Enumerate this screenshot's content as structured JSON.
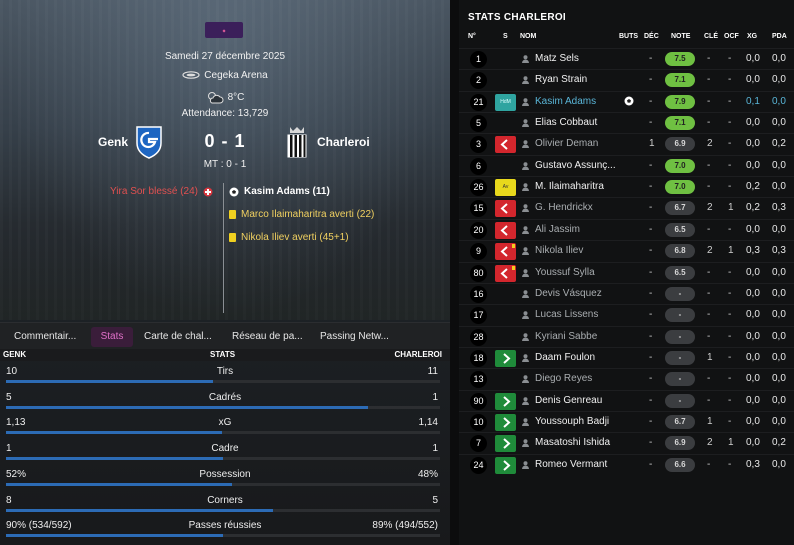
{
  "match": {
    "league_logo": "league-logo",
    "date": "Samedi 27 décembre 2025",
    "venue": "Cegeka Arena",
    "weather": "8°C",
    "attendance": "Attendance: 13,729",
    "home_team": "Genk",
    "away_team": "Charleroi",
    "score": "0 - 1",
    "half_time": "MT : 0 - 1",
    "home_events": [
      {
        "text": "Yira Sor blessé (24)",
        "icon": "injury-icon"
      }
    ],
    "away_events": [
      {
        "text": "Kasim Adams (11)",
        "icon": "goal-ball-icon"
      },
      {
        "text": "Marco Ilaimaharitra averti (22)",
        "icon": "yellow-card-icon"
      },
      {
        "text": "Nikola Iliev averti (45+1)",
        "icon": "yellow-card-icon"
      }
    ]
  },
  "tabs": [
    "Commentair...",
    "Stats",
    "Carte de chal...",
    "Réseau de pa...",
    "Passing Netw..."
  ],
  "active_tab": "Stats",
  "stats": {
    "home_header": "GENK",
    "center_header": "STATS",
    "away_header": "CHARLEROI",
    "rows": [
      {
        "label": "Tirs",
        "home": "10",
        "away": "11",
        "home_share": 0.476
      },
      {
        "label": "Cadrés",
        "home": "5",
        "away": "1",
        "home_share": 0.833
      },
      {
        "label": "xG",
        "home": "1,13",
        "away": "1,14",
        "home_share": 0.498
      },
      {
        "label": "Cadre",
        "home": "1",
        "away": "1",
        "home_share": 0.5
      },
      {
        "label": "Possession",
        "home": "52%",
        "away": "48%",
        "home_share": 0.52
      },
      {
        "label": "Corners",
        "home": "8",
        "away": "5",
        "home_share": 0.615
      },
      {
        "label": "Passes réussies",
        "home": "90% (534/592)",
        "away": "89% (494/552)",
        "home_share": 0.5
      }
    ]
  },
  "team_stats": {
    "title": "STATS CHARLEROI",
    "columns": {
      "num": "N°",
      "s": "S",
      "nom": "NOM",
      "buts": "BUTS",
      "dec": "DÉC",
      "note": "NOTE",
      "cle": "CLÉ",
      "ocf": "OCF",
      "xg": "XG",
      "pda": "PDA"
    },
    "colors": {
      "good_rating": "#6fc042",
      "sub_in": "#1f8b3a",
      "sub_out": "#d3262d",
      "highlight": "#5ab6d8"
    },
    "players": [
      {
        "num": "1",
        "badge": "",
        "name": "Matz Sels",
        "dim": false,
        "hl": false,
        "goal": false,
        "dec": "-",
        "note": "7.5",
        "good": true,
        "cle": "-",
        "ocf": "-",
        "xg": "0,0",
        "pda": "0,0"
      },
      {
        "num": "2",
        "badge": "",
        "name": "Ryan Strain",
        "dim": false,
        "hl": false,
        "goal": false,
        "dec": "-",
        "note": "7.1",
        "good": true,
        "cle": "-",
        "ocf": "-",
        "xg": "0,0",
        "pda": "0,0"
      },
      {
        "num": "21",
        "badge": "teal",
        "badge_text": "HdM",
        "name": "Kasim Adams",
        "dim": false,
        "hl": true,
        "goal": true,
        "dec": "-",
        "note": "7.9",
        "good": true,
        "cle": "-",
        "ocf": "-",
        "xg": "0,1",
        "pda": "0,0"
      },
      {
        "num": "5",
        "badge": "",
        "name": "Elias Cobbaut",
        "dim": false,
        "hl": false,
        "goal": false,
        "dec": "-",
        "note": "7.1",
        "good": true,
        "cle": "-",
        "ocf": "-",
        "xg": "0,0",
        "pda": "0,0"
      },
      {
        "num": "3",
        "badge": "out",
        "name": "Olivier Deman",
        "dim": true,
        "hl": false,
        "goal": false,
        "dec": "1",
        "note": "6.9",
        "good": false,
        "cle": "2",
        "ocf": "-",
        "xg": "0,0",
        "pda": "0,2"
      },
      {
        "num": "6",
        "badge": "",
        "name": "Gustavo Assunç...",
        "dim": false,
        "hl": false,
        "goal": false,
        "dec": "-",
        "note": "7.0",
        "good": true,
        "cle": "-",
        "ocf": "-",
        "xg": "0,0",
        "pda": "0,0"
      },
      {
        "num": "26",
        "badge": "yellow",
        "badge_text": "Av",
        "name": "M. Ilaimaharitra",
        "dim": false,
        "hl": false,
        "goal": false,
        "dec": "-",
        "note": "7.0",
        "good": true,
        "cle": "-",
        "ocf": "-",
        "xg": "0,2",
        "pda": "0,0"
      },
      {
        "num": "15",
        "badge": "out",
        "name": "G. Hendrickx",
        "dim": true,
        "hl": false,
        "goal": false,
        "dec": "-",
        "note": "6.7",
        "good": false,
        "cle": "2",
        "ocf": "1",
        "xg": "0,2",
        "pda": "0,3"
      },
      {
        "num": "20",
        "badge": "out",
        "name": "Ali Jassim",
        "dim": true,
        "hl": false,
        "goal": false,
        "dec": "-",
        "note": "6.5",
        "good": false,
        "cle": "-",
        "ocf": "-",
        "xg": "0,0",
        "pda": "0,0"
      },
      {
        "num": "9",
        "badge": "out-yellow",
        "name": "Nikola Iliev",
        "dim": true,
        "hl": false,
        "goal": false,
        "dec": "-",
        "note": "6.8",
        "good": false,
        "cle": "2",
        "ocf": "1",
        "xg": "0,3",
        "pda": "0,3"
      },
      {
        "num": "80",
        "badge": "out-yellow",
        "name": "Youssuf Sylla",
        "dim": true,
        "hl": false,
        "goal": false,
        "dec": "-",
        "note": "6.5",
        "good": false,
        "cle": "-",
        "ocf": "-",
        "xg": "0,0",
        "pda": "0,0"
      },
      {
        "num": "16",
        "badge": "",
        "name": "Devis Vásquez",
        "dim": true,
        "hl": false,
        "goal": false,
        "dec": "-",
        "note": "-",
        "good": false,
        "cle": "-",
        "ocf": "-",
        "xg": "0,0",
        "pda": "0,0"
      },
      {
        "num": "17",
        "badge": "",
        "name": "Lucas Lissens",
        "dim": true,
        "hl": false,
        "goal": false,
        "dec": "-",
        "note": "-",
        "good": false,
        "cle": "-",
        "ocf": "-",
        "xg": "0,0",
        "pda": "0,0"
      },
      {
        "num": "28",
        "badge": "",
        "name": "Kyriani Sabbe",
        "dim": true,
        "hl": false,
        "goal": false,
        "dec": "-",
        "note": "-",
        "good": false,
        "cle": "-",
        "ocf": "-",
        "xg": "0,0",
        "pda": "0,0"
      },
      {
        "num": "18",
        "badge": "in",
        "name": "Daam Foulon",
        "dim": false,
        "hl": false,
        "goal": false,
        "dec": "-",
        "note": "-",
        "good": false,
        "cle": "1",
        "ocf": "-",
        "xg": "0,0",
        "pda": "0,0"
      },
      {
        "num": "13",
        "badge": "",
        "name": "Diego Reyes",
        "dim": true,
        "hl": false,
        "goal": false,
        "dec": "-",
        "note": "-",
        "good": false,
        "cle": "-",
        "ocf": "-",
        "xg": "0,0",
        "pda": "0,0"
      },
      {
        "num": "90",
        "badge": "in",
        "name": "Denis Genreau",
        "dim": false,
        "hl": false,
        "goal": false,
        "dec": "-",
        "note": "-",
        "good": false,
        "cle": "-",
        "ocf": "-",
        "xg": "0,0",
        "pda": "0,0"
      },
      {
        "num": "10",
        "badge": "in",
        "name": "Youssouph Badji",
        "dim": false,
        "hl": false,
        "goal": false,
        "dec": "-",
        "note": "6.7",
        "good": false,
        "cle": "1",
        "ocf": "-",
        "xg": "0,0",
        "pda": "0,0"
      },
      {
        "num": "7",
        "badge": "in",
        "name": "Masatoshi Ishida",
        "dim": false,
        "hl": false,
        "goal": false,
        "dec": "-",
        "note": "6.9",
        "good": false,
        "cle": "2",
        "ocf": "1",
        "xg": "0,0",
        "pda": "0,2"
      },
      {
        "num": "24",
        "badge": "in",
        "name": "Romeo Vermant",
        "dim": false,
        "hl": false,
        "goal": false,
        "dec": "-",
        "note": "6.6",
        "good": false,
        "cle": "-",
        "ocf": "-",
        "xg": "0,3",
        "pda": "0,0"
      }
    ]
  }
}
